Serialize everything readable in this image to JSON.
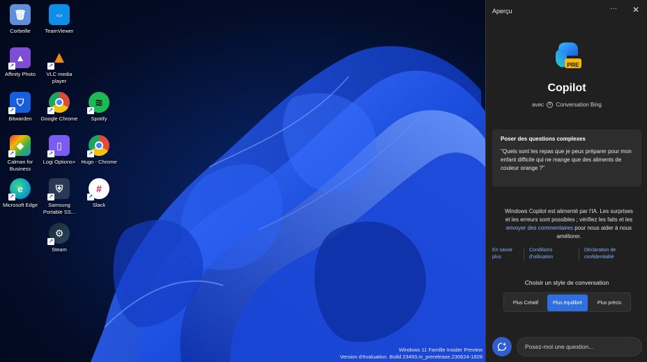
{
  "desktop": {
    "icons": [
      {
        "label": "Corbeille",
        "icon": "recycle-bin-icon",
        "color": "#5f8fd8"
      },
      {
        "label": "TeamViewer",
        "icon": "teamviewer-icon",
        "color": "#0e8ee9"
      },
      {
        "label": "Affinity Photo",
        "icon": "affinity-photo-icon",
        "color": "#7e4dd2"
      },
      {
        "label": "VLC media player",
        "icon": "vlc-icon",
        "color": "#f08a14"
      },
      {
        "label": "Bitwarden",
        "icon": "bitwarden-icon",
        "color": "#175ddc"
      },
      {
        "label": "Google Chrome",
        "icon": "chrome-icon",
        "color": "#dd4b39"
      },
      {
        "label": "Spotify",
        "icon": "spotify-icon",
        "color": "#1db954"
      },
      {
        "label": "Calman for Business",
        "icon": "calman-icon",
        "color": "#e23d3d"
      },
      {
        "label": "Logi Options+",
        "icon": "logi-options-icon",
        "color": "#7a5cf0"
      },
      {
        "label": "Hugo - Chrome",
        "icon": "chrome-profile-icon",
        "color": "#dd4b39"
      },
      {
        "label": "Microsoft Edge",
        "icon": "edge-icon",
        "color": "#0fa0c8"
      },
      {
        "label": "Samsung Portable SS...",
        "icon": "samsung-ssd-icon",
        "color": "#2a3a55"
      },
      {
        "label": "Slack",
        "icon": "slack-icon",
        "color": "#ffffff"
      },
      {
        "label": "Steam",
        "icon": "steam-icon",
        "color": "#1b2838"
      }
    ],
    "watermark": {
      "line1": "Windows 11 Famille Insider Preview",
      "line2": "Version d'évaluation. Build 23493.ni_prerelease.230624-1828"
    }
  },
  "copilot": {
    "window_title": "Aperçu",
    "more_label": "···",
    "close_label": "✕",
    "badge": "PRE",
    "name": "Copilot",
    "subtitle_prefix": "avec",
    "subtitle": "Conversation Bing",
    "card": {
      "title": "Poser des questions complexes",
      "text": "\"Quels sont les repas que je peux préparer pour mon enfant difficile qui ne mange que des aliments de couleur orange ?\""
    },
    "disclaimer": {
      "text_before": "Windows Copilot est alimenté par l'IA. Les surprises et les erreurs sont possibles ; vérifiez les faits et les ",
      "link": "envoyer des commentaires",
      "text_after": " pour nous aider à nous améliorer."
    },
    "links": [
      "En savoir plus",
      "Conditions d'utilisation",
      "Déclaration de confidentialité"
    ],
    "style_heading": "Choisir un style de conversation",
    "styles": [
      {
        "label": "Plus Créatif",
        "active": false
      },
      {
        "label": "Plus équilibré",
        "active": true
      },
      {
        "label": "Plus précis",
        "active": false
      }
    ],
    "input_placeholder": "Posez-moi une question..."
  },
  "colors": {
    "panel_bg": "#202020",
    "accent": "#2f6fe0",
    "link": "#7fb0ff"
  }
}
